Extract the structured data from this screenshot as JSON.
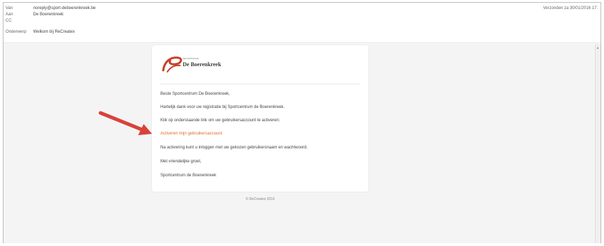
{
  "header": {
    "from_label": "Van",
    "from_value": "noreply@sport-deboerenkreek.be",
    "to_label": "Aan",
    "to_value": "De Boerenkreek",
    "cc_label": "CC",
    "cc_value": "",
    "subject_label": "Onderwerp",
    "subject_value": "Welkom bij ReCreatex",
    "sent_label": "Verzonden",
    "sent_value": "za 30/01/2016 17:"
  },
  "email": {
    "logo_tagline": "sportcentrum",
    "logo_name": "De Boerenkreek",
    "greeting": "Beste Sportcentrum De Boerenkreek,",
    "thanks": "Hartelijk dank voor uw registratie bij Sportcentrum de Boerenkreek.",
    "instruction": "Klik op onderstaande link om uw gebruikersaccount te activeren:",
    "activation_link": "Activeren mijn gebruikersaccount",
    "after_activation": "Na activering kunt u inloggen met uw gekozen gebruikersnaam en wachtwoord.",
    "closing": "Met vriendelijke groet,",
    "signature": "Sportcentrum de Boerenkreek"
  },
  "footer": {
    "copyright": "© ReCreatex 2016"
  },
  "colors": {
    "link": "#e06b2d",
    "arrow": "#d9423a",
    "logo_swoosh": "#c8412b"
  },
  "icons": {
    "arrow": "red-arrow-pointer",
    "logo": "boerenkreek-logo"
  }
}
